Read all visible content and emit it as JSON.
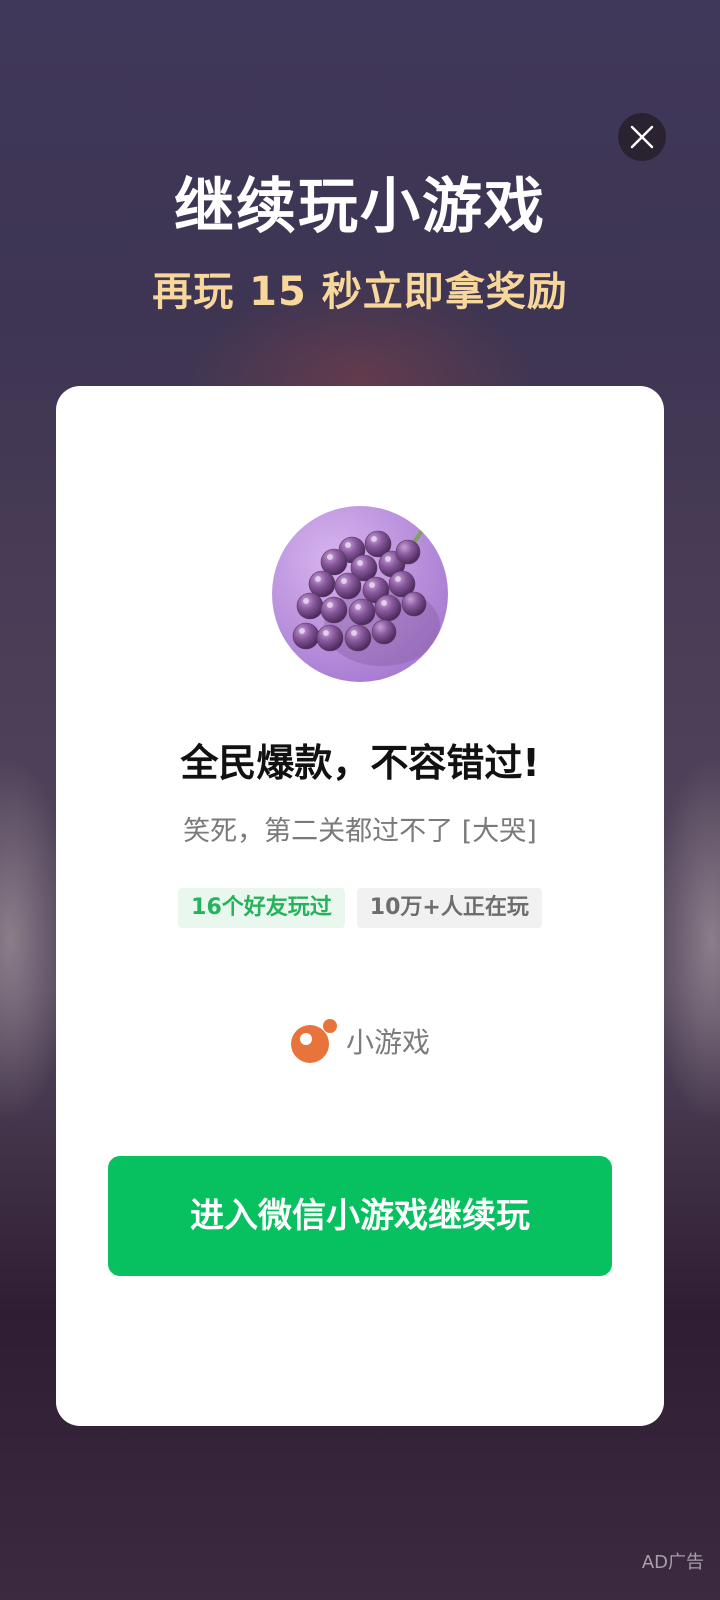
{
  "header": {
    "title": "继续玩小游戏",
    "subtitle": "再玩 15 秒立即拿奖励"
  },
  "close_button": {
    "icon": "close-icon"
  },
  "card": {
    "avatar_icon": "grapes-image",
    "game_name": "全民爆款，不容错过!",
    "description": "笑死，第二关都过不了 [大哭]",
    "tags": [
      {
        "label": "16个好友玩过"
      },
      {
        "label": "10万+人正在玩"
      }
    ],
    "brand": {
      "icon": "mini-game-logo-icon",
      "label": "小游戏"
    },
    "cta_label": "进入微信小游戏继续玩"
  },
  "ad_label": "AD广告",
  "colors": {
    "accent_green": "#07c160",
    "subtitle_gold": "#f7d79a",
    "brand_orange": "#e8743b"
  }
}
